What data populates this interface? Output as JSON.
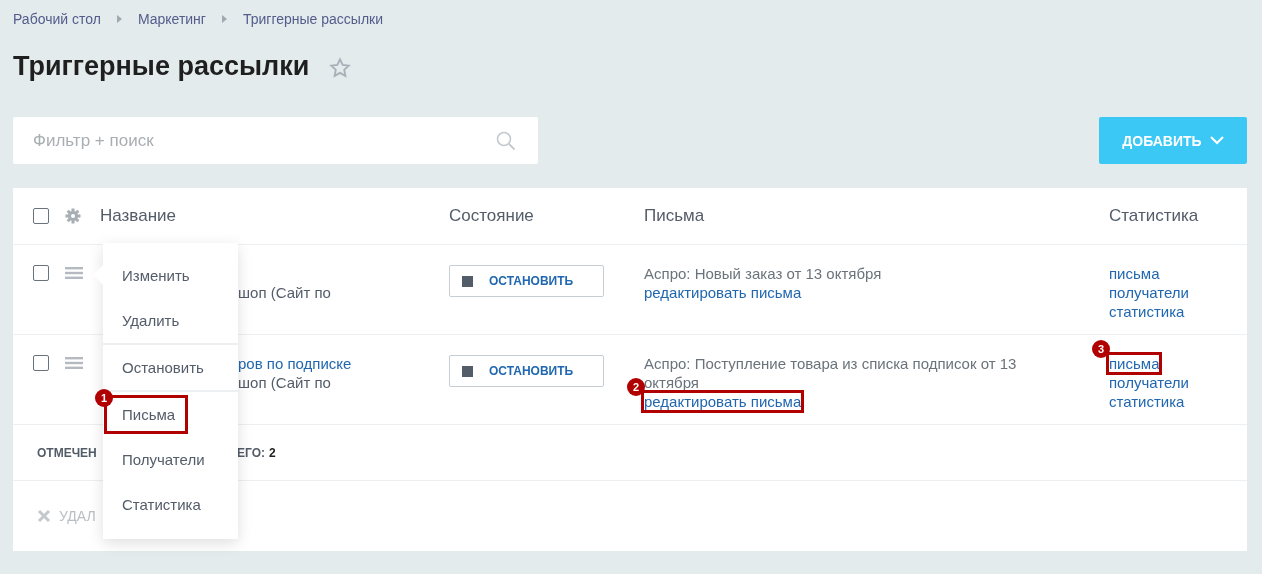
{
  "breadcrumbs": [
    "Рабочий стол",
    "Маркетинг",
    "Триггерные рассылки"
  ],
  "title": "Триггерные рассылки",
  "favorite": false,
  "search": {
    "placeholder": "Фильтр + поиск"
  },
  "add_button": "ДОБАВИТЬ",
  "table": {
    "header_checked": false,
    "columns": [
      "Название",
      "Состояние",
      "Письма",
      "Статистика"
    ],
    "rows": [
      {
        "checked": false,
        "name": {
          "second_line": {
            "text": "шоп (Сайт по",
            "kind": "text"
          }
        },
        "state_button": "ОСТАНОВИТЬ",
        "letter": "Аспро: Новый заказ от 13 октября",
        "edit_link": {
          "text": "редактировать письма"
        },
        "stats": [
          {
            "text": "письма"
          },
          {
            "text": "получатели"
          },
          {
            "text": "статистика"
          }
        ]
      },
      {
        "checked": false,
        "name": {
          "first_line": {
            "text": "ров по подписке",
            "kind": "link"
          },
          "second_line": {
            "text": "шоп (Сайт по",
            "kind": "text"
          }
        },
        "state_button": "ОСТАНОВИТЬ",
        "letter": "Аспро: Поступление товара из списка подписок от 13 октября",
        "edit_link": {
          "text": "редактировать письма",
          "annotation": "2"
        },
        "stats": [
          {
            "text": "письма",
            "annotation": "3"
          },
          {
            "text": "получатели"
          },
          {
            "text": "статистика"
          }
        ]
      }
    ],
    "footer": {
      "selected_label": "ОТМЕЧЕН",
      "total_label": "ЕГО:",
      "total": "2"
    },
    "actions": {
      "delete": "УДАЛ"
    }
  },
  "menu": {
    "items": [
      {
        "label": "Изменить",
        "divider_after": false
      },
      {
        "label": "Удалить",
        "divider_after": true
      },
      {
        "label": "Остановить",
        "divider_after": true
      },
      {
        "label": "Письма",
        "divider_after": false,
        "annotation": "1"
      },
      {
        "label": "Получатели",
        "divider_after": false
      },
      {
        "label": "Статистика",
        "divider_after": false
      }
    ]
  }
}
